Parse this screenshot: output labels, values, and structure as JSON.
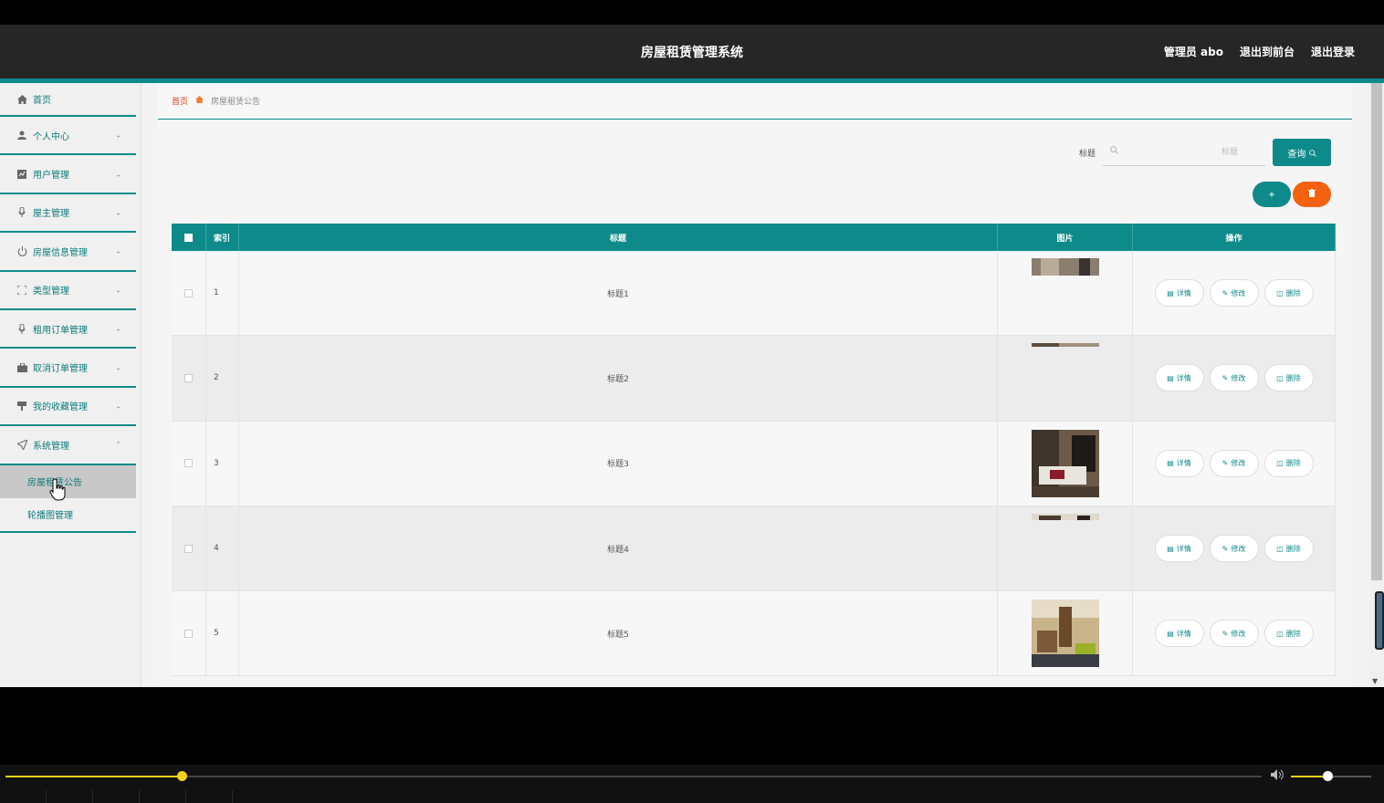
{
  "header": {
    "title": "房屋租赁管理系统",
    "user": "管理员 abo",
    "to_front": "退出到前台",
    "logout": "退出登录"
  },
  "sidebar": {
    "items": [
      {
        "label": "首页",
        "icon": "home-icon"
      },
      {
        "label": "个人中心",
        "icon": "user-icon"
      },
      {
        "label": "用户管理",
        "icon": "chart-icon"
      },
      {
        "label": "屋主管理",
        "icon": "mic-icon"
      },
      {
        "label": "房屋信息管理",
        "icon": "power-icon"
      },
      {
        "label": "类型管理",
        "icon": "expand-icon"
      },
      {
        "label": "租用订单管理",
        "icon": "mic-icon"
      },
      {
        "label": "取消订单管理",
        "icon": "briefcase-icon"
      },
      {
        "label": "我的收藏管理",
        "icon": "cup-icon"
      },
      {
        "label": "系统管理",
        "icon": "send-icon"
      }
    ],
    "sub_items": [
      {
        "label": "房屋租赁公告"
      },
      {
        "label": "轮播图管理"
      }
    ]
  },
  "breadcrumb": {
    "home": "首页",
    "current": "房屋租赁公告"
  },
  "search": {
    "label": "标题",
    "placeholder": "标题",
    "button": "查询"
  },
  "table": {
    "headers": {
      "index": "索引",
      "title": "标题",
      "image": "图片",
      "ops": "操作"
    },
    "rows": [
      {
        "index": "1",
        "title": "标题1"
      },
      {
        "index": "2",
        "title": "标题2"
      },
      {
        "index": "3",
        "title": "标题3"
      },
      {
        "index": "4",
        "title": "标题4"
      },
      {
        "index": "5",
        "title": "标题5"
      }
    ],
    "op_labels": {
      "detail": "详情",
      "edit": "修改",
      "delete": "删除"
    }
  },
  "video": {
    "seek_progress": 0.14,
    "volume": 0.45
  },
  "colors": {
    "accent": "#0e8a8a",
    "danger": "#f5620f",
    "header_bg": "#262626"
  }
}
